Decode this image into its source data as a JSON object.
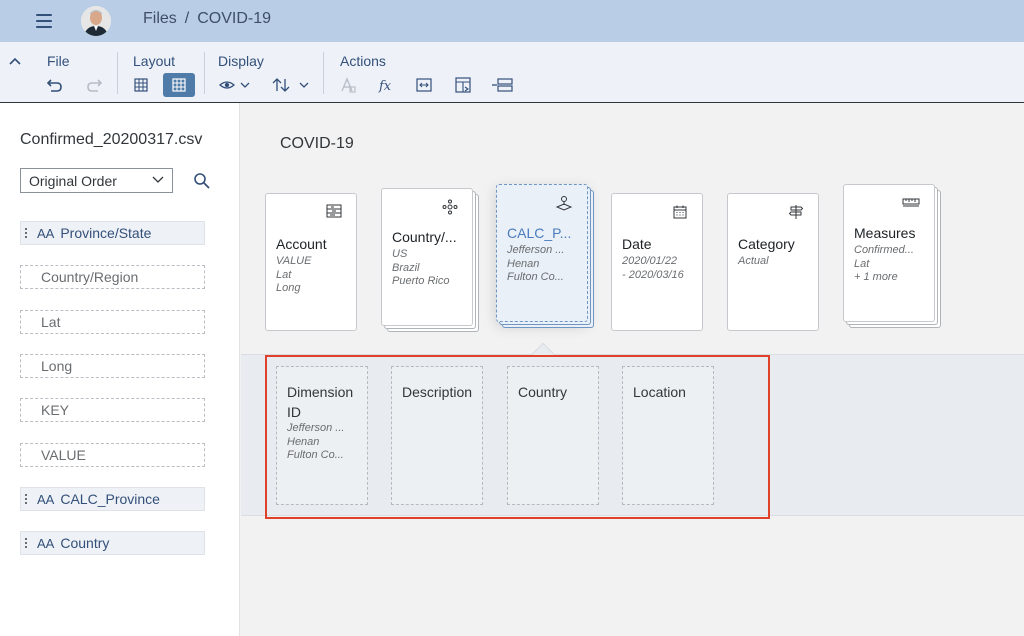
{
  "shell": {
    "breadcrumb": [
      "Files",
      "COVID-19"
    ],
    "breadcrumb_sep": "/"
  },
  "toolbar": {
    "groups": {
      "file": "File",
      "layout": "Layout",
      "display": "Display",
      "actions": "Actions"
    },
    "icons": {
      "undo": "undo-icon",
      "redo": "redo-icon",
      "grid": "grid-view-icon",
      "card": "card-view-icon",
      "eye": "eye-icon",
      "sort": "sort-icon",
      "formula": "formula-icon"
    }
  },
  "sidebar": {
    "file_name": "Confirmed_20200317.csv",
    "order_select": "Original Order",
    "fields": [
      {
        "label": "Province/State",
        "type": "dimension"
      },
      {
        "label": "Country/Region",
        "type": "plain"
      },
      {
        "label": "Lat",
        "type": "plain"
      },
      {
        "label": "Long",
        "type": "plain"
      },
      {
        "label": "KEY",
        "type": "plain"
      },
      {
        "label": "VALUE",
        "type": "plain"
      },
      {
        "label": "CALC_Province",
        "type": "dimension"
      },
      {
        "label": "Country",
        "type": "dimension"
      }
    ],
    "dim_prefix": "AA"
  },
  "main": {
    "title": "COVID-19",
    "cards": [
      {
        "name": "Account",
        "values": [
          "VALUE",
          "Lat",
          "Long"
        ],
        "icon": "account-icon"
      },
      {
        "name": "Country/...",
        "values": [
          "US",
          "Brazil",
          "Puerto Rico"
        ],
        "icon": "hierarchy-icon"
      },
      {
        "name": "CALC_P...",
        "values": [
          "Jefferson ...",
          "Henan",
          "Fulton Co..."
        ],
        "icon": "geo-location-icon"
      },
      {
        "name": "Date",
        "values": [
          "2020/01/22",
          "- 2020/03/16"
        ],
        "icon": "calendar-icon"
      },
      {
        "name": "Category",
        "values": [
          "Actual"
        ],
        "icon": "signpost-icon"
      },
      {
        "name": "Measures",
        "values": [
          "Confirmed...",
          "Lat",
          "+ 1 more"
        ],
        "icon": "ruler-icon"
      }
    ],
    "attributes": [
      {
        "name": "Dimension ID",
        "values": [
          "Jefferson ...",
          "Henan",
          "Fulton Co..."
        ]
      },
      {
        "name": "Description",
        "values": []
      },
      {
        "name": "Country",
        "values": []
      },
      {
        "name": "Location",
        "values": []
      }
    ]
  },
  "colors": {
    "shell": "#b9cee6",
    "accent": "#4e7ba7",
    "highlight": "#e0412a"
  }
}
